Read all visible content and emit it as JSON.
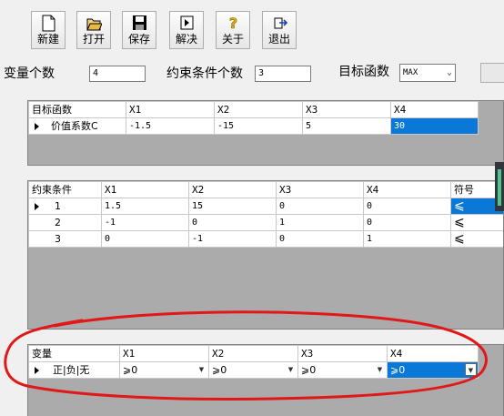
{
  "toolbar": {
    "buttons": [
      {
        "label": "新建",
        "icon": "new-file-icon"
      },
      {
        "label": "打开",
        "icon": "open-folder-icon"
      },
      {
        "label": "保存",
        "icon": "save-icon"
      },
      {
        "label": "解决",
        "icon": "solve-icon"
      },
      {
        "label": "关于",
        "icon": "help-icon"
      },
      {
        "label": "退出",
        "icon": "exit-icon"
      }
    ]
  },
  "params": {
    "var_count_label": "变量个数",
    "var_count_value": "4",
    "constraint_count_label": "约束条件个数",
    "constraint_count_value": "3",
    "objective_label": "目标函数",
    "objective_value": "MAX"
  },
  "objective_table": {
    "header": [
      "目标函数",
      "X1",
      "X2",
      "X3",
      "X4"
    ],
    "rows": [
      {
        "label": "价值系数C",
        "values": [
          "-1.5",
          "-15",
          "5",
          "30"
        ]
      }
    ]
  },
  "constraint_table": {
    "header": [
      "约束条件",
      "X1",
      "X2",
      "X3",
      "X4",
      "符号"
    ],
    "rows": [
      {
        "label": "1",
        "values": [
          "1.5",
          "15",
          "0",
          "0"
        ],
        "sign": "⩽"
      },
      {
        "label": "2",
        "values": [
          "-1",
          "0",
          "1",
          "0"
        ],
        "sign": "⩽"
      },
      {
        "label": "3",
        "values": [
          "0",
          "-1",
          "0",
          "1"
        ],
        "sign": "⩽"
      }
    ]
  },
  "variable_table": {
    "header": [
      "变量",
      "X1",
      "X2",
      "X3",
      "X4"
    ],
    "rows": [
      {
        "label": "正|负|无",
        "values": [
          "⩾0",
          "⩾0",
          "⩾0",
          "⩾0"
        ]
      }
    ]
  },
  "colors": {
    "selection": "#0a78d7",
    "annotation": "#e01818"
  }
}
